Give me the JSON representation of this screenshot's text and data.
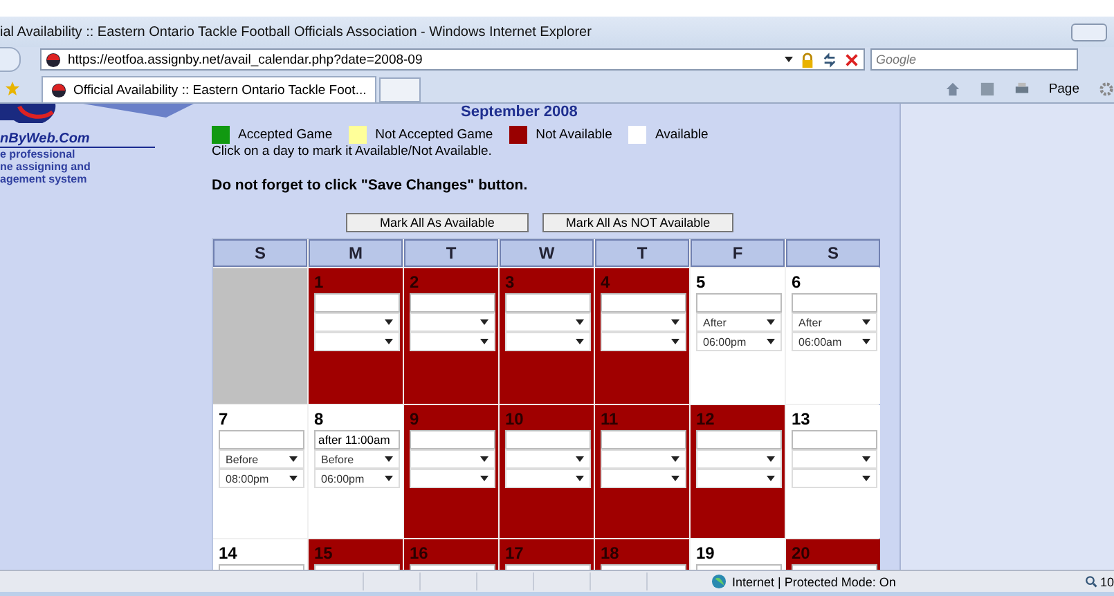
{
  "window": {
    "title": "ial Availability :: Eastern Ontario Tackle Football Officials Association - Windows Internet Explorer"
  },
  "address_bar": {
    "url": "https://eotfoa.assignby.net/avail_calendar.php?date=2008-09",
    "search_placeholder": "Google"
  },
  "tabs": [
    {
      "label": "Official Availability :: Eastern Ontario Tackle Foot...",
      "selected": true
    }
  ],
  "toolbar": {
    "page_menu": "Page"
  },
  "sidebar": {
    "logo": "nByWeb.Com",
    "tagline": [
      "e professional",
      "ne assigning and",
      "agement system"
    ]
  },
  "calendar": {
    "month": "September 2008",
    "legend": [
      {
        "label": "Accepted Game",
        "color": "#119911"
      },
      {
        "label": "Not Accepted Game",
        "color": "#ffff99"
      },
      {
        "label": "Not Available",
        "color": "#990000"
      },
      {
        "label": "Available",
        "color": "#ffffff"
      }
    ],
    "instruction": "Click on a day to mark it Available/Not Available.",
    "reminder": "Do not forget to click \"Save Changes\" button.",
    "buttons": [
      "Mark All As Available",
      "Mark All As NOT Available"
    ],
    "weekdays": [
      "S",
      "M",
      "T",
      "W",
      "T",
      "F",
      "S"
    ],
    "weeks": [
      {
        "days": [
          {
            "kind": "blank"
          },
          {
            "kind": "day",
            "day": "1",
            "available": false
          },
          {
            "kind": "day",
            "day": "2",
            "available": false
          },
          {
            "kind": "day",
            "day": "3",
            "available": false
          },
          {
            "kind": "day",
            "day": "4",
            "available": false
          },
          {
            "kind": "day",
            "day": "5",
            "available": true,
            "condition": "After",
            "time": "06:00pm"
          },
          {
            "kind": "day",
            "day": "6",
            "available": true,
            "condition": "After",
            "time": "06:00am"
          }
        ]
      },
      {
        "days": [
          {
            "kind": "day",
            "day": "7",
            "available": true,
            "condition": "Before",
            "time": "08:00pm"
          },
          {
            "kind": "day",
            "day": "8",
            "available": true,
            "note": "after 11:00am",
            "condition": "Before",
            "time": "06:00pm"
          },
          {
            "kind": "day",
            "day": "9",
            "available": false
          },
          {
            "kind": "day",
            "day": "10",
            "available": false
          },
          {
            "kind": "day",
            "day": "11",
            "available": false
          },
          {
            "kind": "day",
            "day": "12",
            "available": false
          },
          {
            "kind": "day",
            "day": "13",
            "available": true
          }
        ]
      },
      {
        "days": [
          {
            "kind": "cut_day",
            "day": "14",
            "available": true
          },
          {
            "kind": "cut_day",
            "day": "15",
            "available": false
          },
          {
            "kind": "cut_day",
            "day": "16",
            "available": false
          },
          {
            "kind": "cut_day",
            "day": "17",
            "available": false
          },
          {
            "kind": "cut_day",
            "day": "18",
            "available": false
          },
          {
            "kind": "cut_day",
            "day": "19",
            "available": true
          },
          {
            "kind": "cut_day",
            "day": "20",
            "available": false
          }
        ]
      }
    ]
  },
  "status_bar": {
    "zone": "Internet | Protected Mode: On",
    "zoom": "10"
  }
}
